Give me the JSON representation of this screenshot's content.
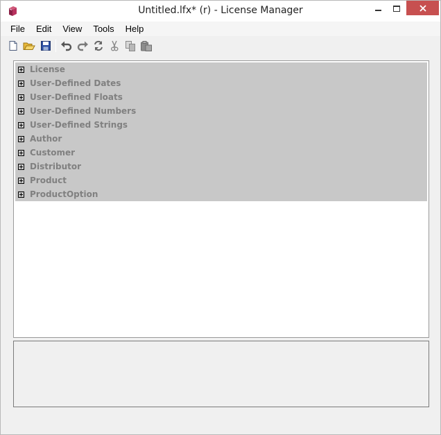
{
  "window": {
    "title": "Untitled.lfx* (r) - License Manager"
  },
  "icons": {
    "app": "license-book-icon",
    "minimize": "minimize-icon",
    "maximize": "maximize-icon",
    "close": "close-icon"
  },
  "colors": {
    "close_button": "#c75050",
    "tree_selection_bg": "#c8c8c8",
    "tree_label": "#808080"
  },
  "menu": {
    "items": [
      "File",
      "Edit",
      "View",
      "Tools",
      "Help"
    ]
  },
  "toolbar": {
    "buttons": [
      "new-file-icon",
      "open-folder-icon",
      "save-icon",
      "undo-icon",
      "redo-icon",
      "refresh-icon",
      "cut-icon",
      "copy-icon",
      "paste-icon"
    ]
  },
  "tree": {
    "items": [
      {
        "label": "License"
      },
      {
        "label": "User-Defined Dates"
      },
      {
        "label": "User-Defined Floats"
      },
      {
        "label": "User-Defined Numbers"
      },
      {
        "label": "User-Defined Strings"
      },
      {
        "label": "Author"
      },
      {
        "label": "Customer"
      },
      {
        "label": "Distributor"
      },
      {
        "label": "Product"
      },
      {
        "label": "ProductOption"
      }
    ]
  }
}
